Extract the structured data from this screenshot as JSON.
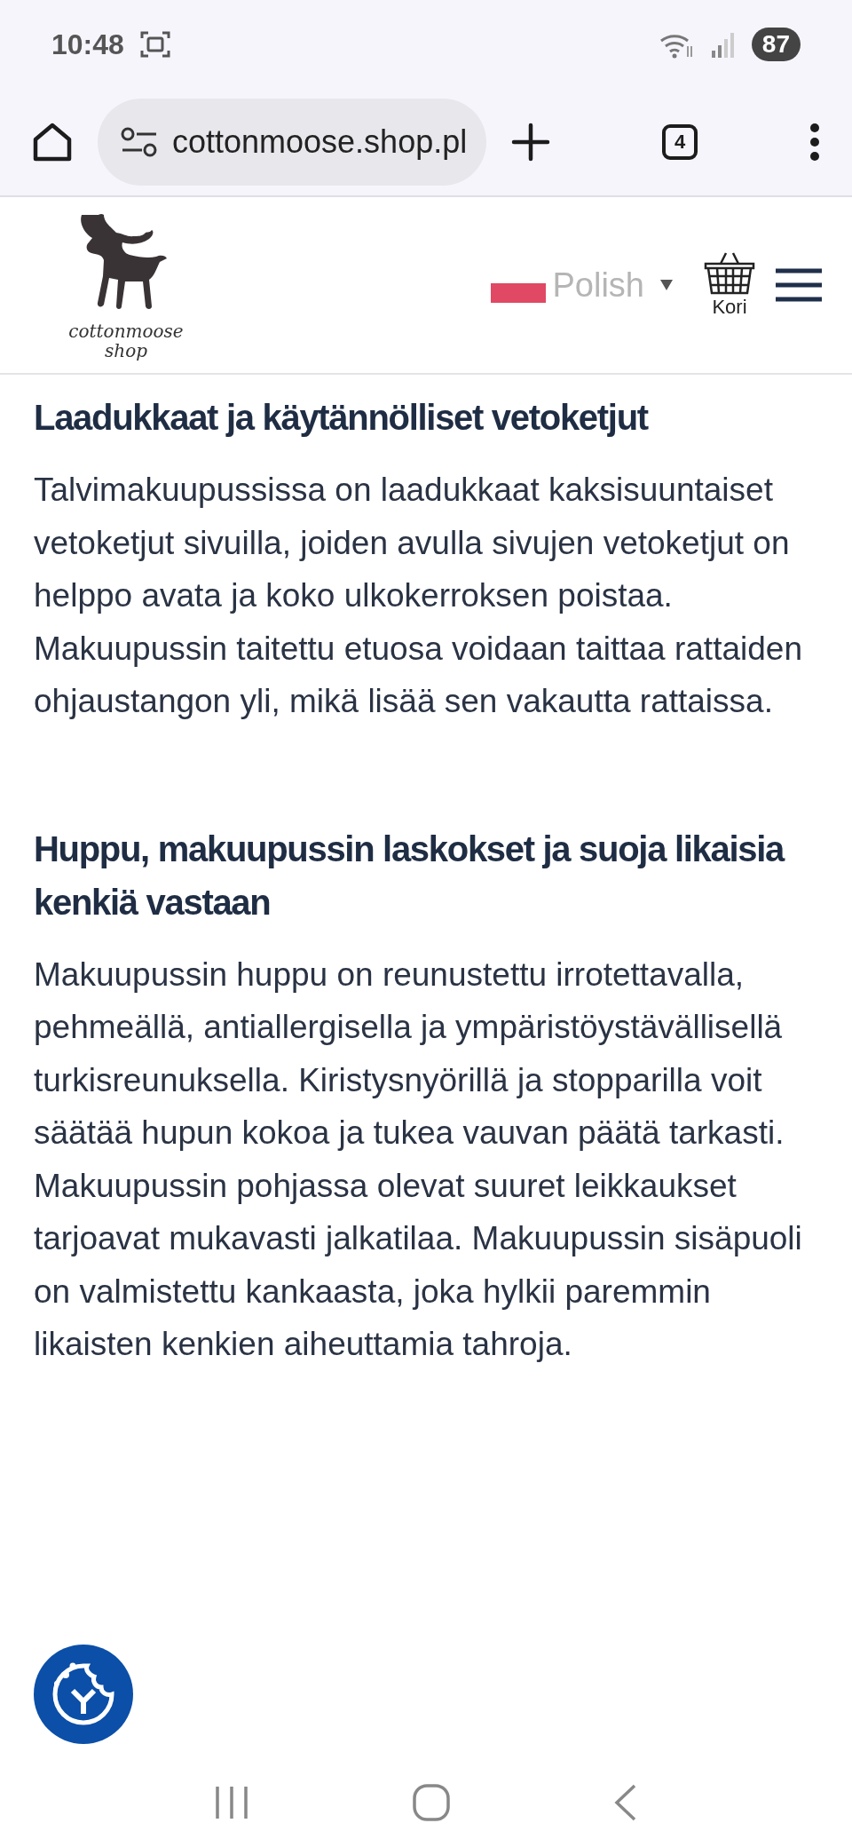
{
  "status_bar": {
    "time": "10:48",
    "battery": "87"
  },
  "browser": {
    "url": "cottonmoose.shop.pl",
    "tab_count": "4"
  },
  "header": {
    "logo_lines": [
      "cottonmoose",
      "shop"
    ],
    "language": "Polish",
    "cart_label": "Kori"
  },
  "sections": [
    {
      "heading": "Laadukkaat ja käytännölliset vetoketjut",
      "body": "Talvimakuupussissa on laadukkaat kaksisuuntaiset vetoketjut sivuilla, joiden avulla sivujen vetoketjut on helppo avata ja koko ulkokerroksen poistaa. Makuupussin taitettu etuosa voidaan taittaa rattaiden ohjaustangon yli, mikä lisää sen vakautta rattaissa."
    },
    {
      "heading": "Huppu, makuupussin laskokset ja suoja likaisia kenkiä vastaan",
      "body": "Makuupussin huppu on reunustettu irrotettavalla, pehmeällä, antiallergisella ja ympäristöystävällisellä turkisreunuksella. Kiristysnyörillä ja stopparilla voit säätää hupun kokoa ja tukea vauvan päätä tarkasti. Makuupussin pohjassa olevat suuret leikkaukset tarjoavat mukavasti jalkatilaa. Makuupussin sisäpuoli on valmistettu kankaasta, joka hylkii paremmin likaisten kenkien aiheuttamia tahroja."
    }
  ]
}
